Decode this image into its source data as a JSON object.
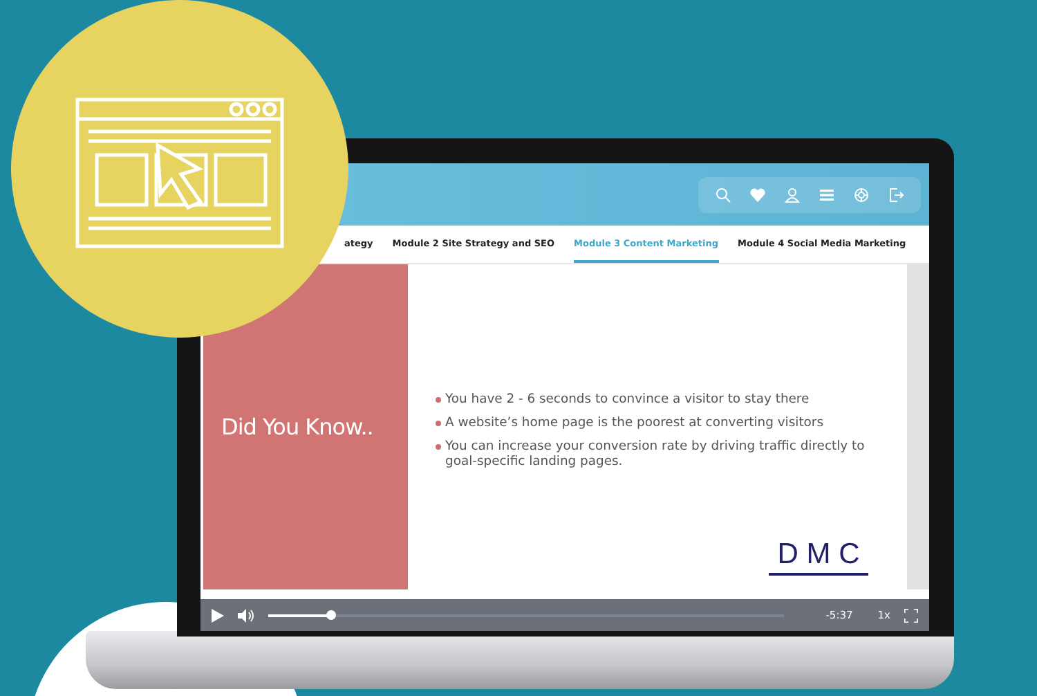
{
  "tabs": [
    {
      "label": "ategy",
      "selected": false
    },
    {
      "label": "Module 2 Site Strategy and SEO",
      "selected": false
    },
    {
      "label": "Module 3 Content Marketing",
      "selected": true
    },
    {
      "label": "Module 4 Social Media Marketing",
      "selected": false
    }
  ],
  "slide": {
    "title": "Did You Know..",
    "bullets": [
      "You have 2 - 6 seconds to convince a visitor to stay there",
      "A website’s home page is the poorest at converting visitors",
      "You can increase your conversion rate by driving traffic directly to goal-specific landing pages."
    ],
    "logo": "D M C"
  },
  "player": {
    "level": 0.12,
    "time": "-5:37",
    "speed": "1x"
  }
}
